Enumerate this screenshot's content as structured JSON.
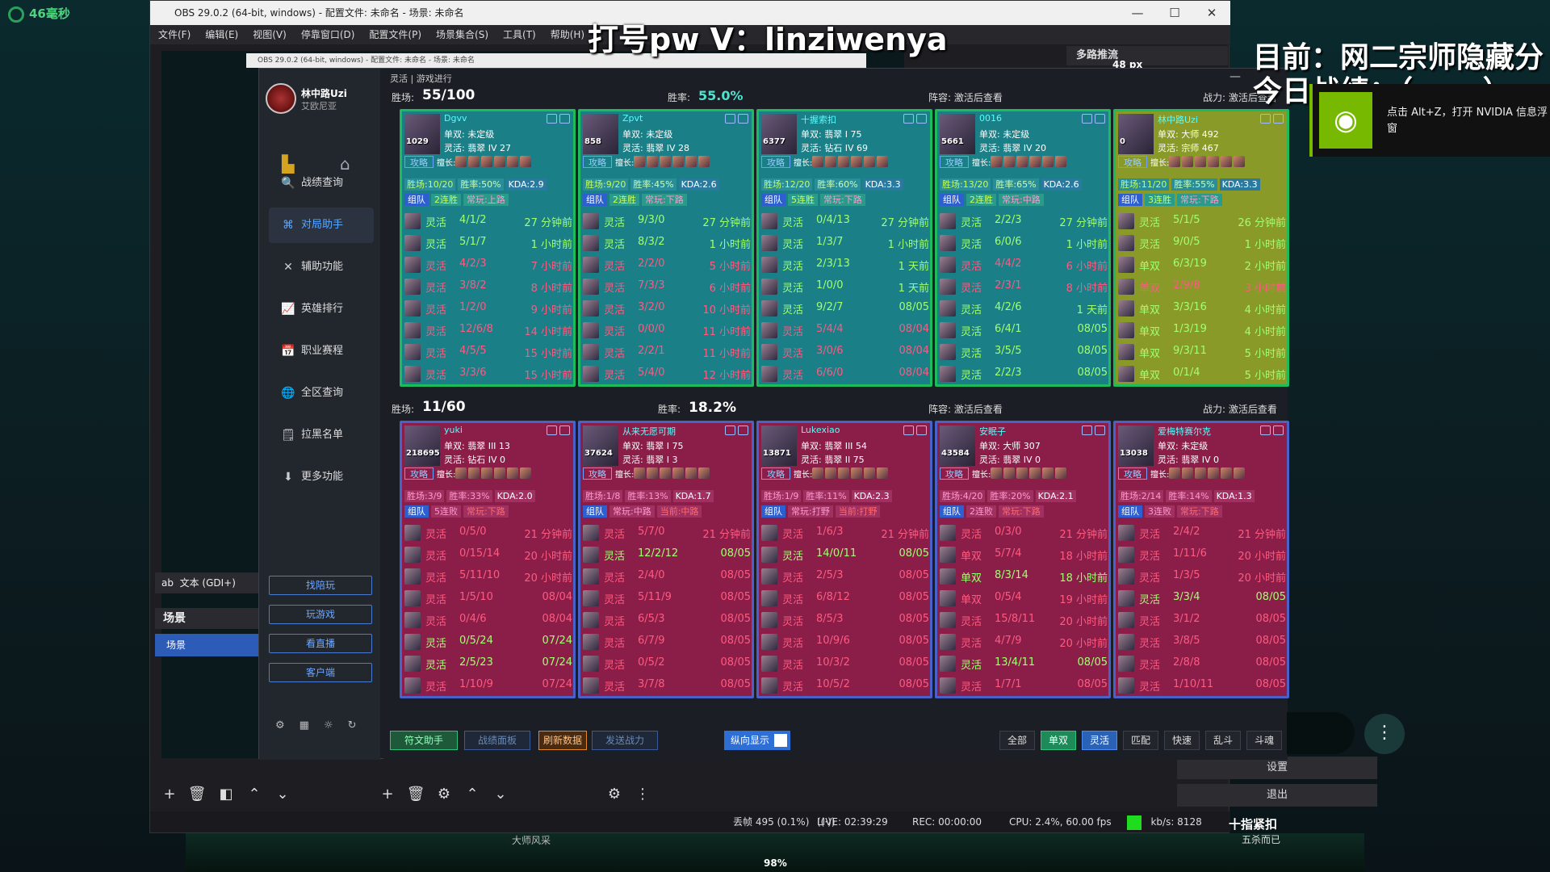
{
  "overlay": {
    "latency": "46毫秒",
    "watermark": "打号pw V：linziwenya",
    "right_line1": "目前：网二宗师隐藏分",
    "right_line2": "今日战绩：（mvp）"
  },
  "nvidia": {
    "tip": "点击 Alt+Z，打开 NVIDIA 信息浮窗"
  },
  "obs": {
    "title": "OBS 29.0.2 (64-bit, windows) - 配置文件: 未命名 - 场景: 未命名",
    "menu": [
      "文件(F)",
      "编辑(E)",
      "视图(V)",
      "停靠窗口(D)",
      "配置文件(P)",
      "场景集合(S)",
      "工具(T)",
      "帮助(H)"
    ],
    "dock_title": "多路推流",
    "px_label": "48 px",
    "source": "文本 (GDI+)",
    "scene_header": "场景",
    "scene_item": "场景",
    "settings": "设置",
    "exit": "退出",
    "status": {
      "dropped": "丢帧 495 (0.1%)",
      "live": "LIVE: 02:39:29",
      "rec": "REC: 00:00:00",
      "cpu": "CPU: 2.4%, 60.00 fps",
      "kbs": "kb/s: 8128"
    },
    "inner_title": "OBS 29.0.2 (64-bit, windows) - 配置文件: 未命名 - 场景: 未命名"
  },
  "app": {
    "title": "灵活 | 游戏进行",
    "user": {
      "name": "林中路Uzi",
      "server": "艾欧尼亚"
    },
    "nav": [
      {
        "label": "战绩查询",
        "icon": "🔍"
      },
      {
        "label": "对局助手",
        "icon": "⌘"
      },
      {
        "label": "辅助功能",
        "icon": "✕"
      },
      {
        "label": "英雄排行",
        "icon": "📈"
      },
      {
        "label": "职业赛程",
        "icon": "📅"
      },
      {
        "label": "全区查询",
        "icon": "🌐"
      },
      {
        "label": "拉黑名单",
        "icon": "🗒"
      },
      {
        "label": "更多功能",
        "icon": "⬇"
      }
    ],
    "side_buttons": [
      "找陪玩",
      "玩游戏",
      "看直播",
      "客户端"
    ],
    "teams": [
      {
        "record_label": "胜场:",
        "record": "55/100",
        "winrate_label": "胜率:",
        "winrate": "55.0%",
        "lineup": "阵容: 激活后查看",
        "power": "战力: 激活后查看",
        "players": [
          {
            "name": "Dgvv",
            "level": "1029",
            "solo": "单双: 未定级",
            "flex": "灵活: 翡翠 IV 27",
            "stats": [
              "胜场:10/20",
              "胜率:50%",
              "KDA:2.9"
            ],
            "tags": [
              "组队",
              "2连胜",
              "常玩:上路"
            ],
            "games": [
              [
                "灵活",
                "4/1/2",
                "27 分钟前",
                "w"
              ],
              [
                "灵活",
                "5/1/7",
                "1 小时前",
                "w"
              ],
              [
                "灵活",
                "4/2/3",
                "7 小时前",
                "l"
              ],
              [
                "灵活",
                "3/8/2",
                "8 小时前",
                "l"
              ],
              [
                "灵活",
                "1/2/0",
                "9 小时前",
                "l"
              ],
              [
                "灵活",
                "12/6/8",
                "14 小时前",
                "l"
              ],
              [
                "灵活",
                "4/5/5",
                "15 小时前",
                "l"
              ],
              [
                "灵活",
                "3/3/6",
                "15 小时前",
                "l"
              ]
            ]
          },
          {
            "name": "Zpvt",
            "level": "858",
            "solo": "单双: 未定级",
            "flex": "灵活: 翡翠 IV 28",
            "stats": [
              "胜场:9/20",
              "胜率:45%",
              "KDA:2.6"
            ],
            "tags": [
              "组队",
              "2连胜",
              "常玩:下路"
            ],
            "games": [
              [
                "灵活",
                "9/3/0",
                "27 分钟前",
                "w"
              ],
              [
                "灵活",
                "8/3/2",
                "1 小时前",
                "w"
              ],
              [
                "灵活",
                "2/2/0",
                "5 小时前",
                "l"
              ],
              [
                "灵活",
                "7/3/3",
                "6 小时前",
                "l"
              ],
              [
                "灵活",
                "3/2/0",
                "10 小时前",
                "l"
              ],
              [
                "灵活",
                "0/0/0",
                "11 小时前",
                "l"
              ],
              [
                "灵活",
                "2/2/1",
                "11 小时前",
                "l"
              ],
              [
                "灵活",
                "5/4/0",
                "12 小时前",
                "l"
              ]
            ]
          },
          {
            "name": "十握索扣",
            "level": "6377",
            "solo": "单双: 翡翠 I 75",
            "flex": "灵活: 钻石 IV 69",
            "stats": [
              "胜场:12/20",
              "胜率:60%",
              "KDA:3.3"
            ],
            "tags": [
              "组队",
              "5连胜",
              "常玩:下路"
            ],
            "games": [
              [
                "灵活",
                "0/4/13",
                "27 分钟前",
                "w"
              ],
              [
                "灵活",
                "1/3/7",
                "1 小时前",
                "w"
              ],
              [
                "灵活",
                "2/3/13",
                "1 天前",
                "w"
              ],
              [
                "灵活",
                "1/0/0",
                "1 天前",
                "w"
              ],
              [
                "灵活",
                "9/2/7",
                "08/05",
                "w"
              ],
              [
                "灵活",
                "5/4/4",
                "08/04",
                "l"
              ],
              [
                "灵活",
                "3/0/6",
                "08/04",
                "l"
              ],
              [
                "灵活",
                "6/6/0",
                "08/04",
                "l"
              ]
            ]
          },
          {
            "name": "0016",
            "level": "5661",
            "solo": "单双: 未定级",
            "flex": "灵活: 翡翠 IV 20",
            "stats": [
              "胜场:13/20",
              "胜率:65%",
              "KDA:2.6"
            ],
            "tags": [
              "组队",
              "2连胜",
              "常玩:中路"
            ],
            "games": [
              [
                "灵活",
                "2/2/3",
                "27 分钟前",
                "w"
              ],
              [
                "灵活",
                "6/0/6",
                "1 小时前",
                "w"
              ],
              [
                "灵活",
                "4/4/2",
                "6 小时前",
                "l"
              ],
              [
                "灵活",
                "2/3/1",
                "8 小时前",
                "l"
              ],
              [
                "灵活",
                "4/2/6",
                "1 天前",
                "w"
              ],
              [
                "灵活",
                "6/4/1",
                "08/05",
                "w"
              ],
              [
                "灵活",
                "3/5/5",
                "08/05",
                "w"
              ],
              [
                "灵活",
                "2/2/3",
                "08/05",
                "w"
              ]
            ]
          },
          {
            "name": "林中路Uzi",
            "level": "0",
            "solo": "单双: 大师 492",
            "flex": "灵活: 宗师 467",
            "stats": [
              "胜场:11/20",
              "胜率:55%",
              "KDA:3.3"
            ],
            "tags": [
              "组队",
              "3连胜",
              "常玩:下路"
            ],
            "games": [
              [
                "灵活",
                "5/1/5",
                "26 分钟前",
                "w"
              ],
              [
                "灵活",
                "9/0/5",
                "1 小时前",
                "w"
              ],
              [
                "单双",
                "6/3/19",
                "2 小时前",
                "w"
              ],
              [
                "单双",
                "2/9/8",
                "3 小时前",
                "l"
              ],
              [
                "单双",
                "3/3/16",
                "4 小时前",
                "w"
              ],
              [
                "单双",
                "1/3/19",
                "4 小时前",
                "w"
              ],
              [
                "单双",
                "9/3/11",
                "5 小时前",
                "w"
              ],
              [
                "单双",
                "0/1/4",
                "5 小时前",
                "w"
              ]
            ]
          }
        ]
      },
      {
        "record_label": "胜场:",
        "record": "11/60",
        "winrate_label": "胜率:",
        "winrate": "18.2%",
        "lineup": "阵容: 激活后查看",
        "power": "战力: 激活后查看",
        "players": [
          {
            "name": "yuki",
            "level": "218695",
            "solo": "单双: 翡翠 III 13",
            "flex": "灵活: 钻石 IV 0",
            "stats": [
              "胜场:3/9",
              "胜率:33%",
              "KDA:2.0"
            ],
            "tags": [
              "组队",
              "5连败",
              "常玩:下路"
            ],
            "games": [
              [
                "灵活",
                "0/5/0",
                "21 分钟前",
                "l"
              ],
              [
                "灵活",
                "0/15/14",
                "20 小时前",
                "l"
              ],
              [
                "灵活",
                "5/11/10",
                "20 小时前",
                "l"
              ],
              [
                "灵活",
                "1/5/10",
                "08/04",
                "l"
              ],
              [
                "灵活",
                "0/4/6",
                "08/04",
                "l"
              ],
              [
                "灵活",
                "0/5/24",
                "07/24",
                "w"
              ],
              [
                "灵活",
                "2/5/23",
                "07/24",
                "w"
              ],
              [
                "灵活",
                "1/10/9",
                "07/24",
                "l"
              ]
            ]
          },
          {
            "name": "从来无愿可期",
            "level": "37624",
            "solo": "单双: 翡翠 I 75",
            "flex": "灵活: 翡翠 I 3",
            "stats": [
              "胜场:1/8",
              "胜率:13%",
              "KDA:1.7"
            ],
            "tags": [
              "组队",
              "常玩:中路",
              "当前:中路"
            ],
            "games": [
              [
                "灵活",
                "5/7/0",
                "21 分钟前",
                "l"
              ],
              [
                "灵活",
                "12/2/12",
                "08/05",
                "w"
              ],
              [
                "灵活",
                "2/4/0",
                "08/05",
                "l"
              ],
              [
                "灵活",
                "5/11/9",
                "08/05",
                "l"
              ],
              [
                "灵活",
                "6/5/3",
                "08/05",
                "l"
              ],
              [
                "灵活",
                "6/7/9",
                "08/05",
                "l"
              ],
              [
                "灵活",
                "0/5/2",
                "08/05",
                "l"
              ],
              [
                "灵活",
                "3/7/8",
                "08/05",
                "l"
              ]
            ]
          },
          {
            "name": "Lukexiao",
            "level": "13871",
            "solo": "单双: 翡翠 III 54",
            "flex": "灵活: 翡翠 II 75",
            "stats": [
              "胜场:1/9",
              "胜率:11%",
              "KDA:2.3"
            ],
            "tags": [
              "组队",
              "常玩:打野",
              "当前:打野"
            ],
            "games": [
              [
                "灵活",
                "1/6/3",
                "21 分钟前",
                "l"
              ],
              [
                "灵活",
                "14/0/11",
                "08/05",
                "w"
              ],
              [
                "灵活",
                "2/5/3",
                "08/05",
                "l"
              ],
              [
                "灵活",
                "6/8/12",
                "08/05",
                "l"
              ],
              [
                "灵活",
                "8/5/3",
                "08/05",
                "l"
              ],
              [
                "灵活",
                "10/9/6",
                "08/05",
                "l"
              ],
              [
                "灵活",
                "10/3/2",
                "08/05",
                "l"
              ],
              [
                "灵活",
                "10/5/2",
                "08/05",
                "l"
              ]
            ]
          },
          {
            "name": "安眠子",
            "level": "43584",
            "solo": "单双: 大师 307",
            "flex": "灵活: 翡翠 IV 0",
            "stats": [
              "胜场:4/20",
              "胜率:20%",
              "KDA:2.1"
            ],
            "tags": [
              "组队",
              "2连败",
              "常玩:下路"
            ],
            "games": [
              [
                "灵活",
                "0/3/0",
                "21 分钟前",
                "l"
              ],
              [
                "单双",
                "5/7/4",
                "18 小时前",
                "l"
              ],
              [
                "单双",
                "8/3/14",
                "18 小时前",
                "w"
              ],
              [
                "单双",
                "0/5/4",
                "19 小时前",
                "l"
              ],
              [
                "灵活",
                "15/8/11",
                "20 小时前",
                "l"
              ],
              [
                "灵活",
                "4/7/9",
                "20 小时前",
                "l"
              ],
              [
                "灵活",
                "13/4/11",
                "08/05",
                "w"
              ],
              [
                "灵活",
                "1/7/1",
                "08/05",
                "l"
              ]
            ]
          },
          {
            "name": "爱梅特赛尔克",
            "level": "13038",
            "solo": "单双: 未定级",
            "flex": "灵活: 翡翠 IV 0",
            "stats": [
              "胜场:2/14",
              "胜率:14%",
              "KDA:1.3"
            ],
            "tags": [
              "组队",
              "3连败",
              "常玩:下路"
            ],
            "games": [
              [
                "灵活",
                "2/4/2",
                "21 分钟前",
                "l"
              ],
              [
                "灵活",
                "1/11/6",
                "20 小时前",
                "l"
              ],
              [
                "灵活",
                "1/3/5",
                "20 小时前",
                "l"
              ],
              [
                "灵活",
                "3/3/4",
                "08/05",
                "w"
              ],
              [
                "灵活",
                "3/1/2",
                "08/05",
                "l"
              ],
              [
                "灵活",
                "3/8/5",
                "08/05",
                "l"
              ],
              [
                "灵活",
                "2/8/8",
                "08/05",
                "l"
              ],
              [
                "灵活",
                "1/10/11",
                "08/05",
                "l"
              ]
            ]
          }
        ]
      }
    ],
    "strat_label": "攻略",
    "good_label": "擅长:",
    "footer": {
      "buttons": [
        "符文助手",
        "战绩面板",
        "刷新数据",
        "发送战力"
      ],
      "toggle": "纵向显示",
      "modes": [
        "全部",
        "单双",
        "灵活",
        "匹配",
        "快速",
        "乱斗",
        "斗魂"
      ]
    }
  },
  "game": {
    "label_a": "大师风采",
    "hp": "98%",
    "msg1": "十指紧扣",
    "msg2": "五杀而已"
  }
}
